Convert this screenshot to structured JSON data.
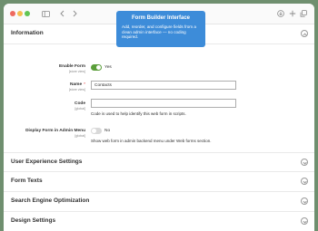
{
  "toolbar": {
    "sidebar_icon": "sidebar-icon",
    "back_icon": "chevron-left-icon",
    "forward_icon": "chevron-right-icon",
    "download_icon": "download-icon",
    "add_icon": "plus-icon",
    "copy_icon": "copy-icon"
  },
  "tooltip": {
    "title": "Form Builder Interface",
    "text": "Add, reorder, and configure fields from a clean admin interface — no coding required."
  },
  "sections": {
    "information": {
      "title": "Information",
      "fields": {
        "enable_form": {
          "label": "Enable Form",
          "scope": "[store view]",
          "value": "Yes",
          "on": true
        },
        "name": {
          "label": "Name",
          "required": "*",
          "scope": "[store view]",
          "value": "Contacts"
        },
        "code": {
          "label": "Code",
          "scope": "[global]",
          "value": "",
          "note": "Code is used to help identify this web form in scripts."
        },
        "display_in_admin_menu": {
          "label": "Display Form in Admin Menu",
          "scope": "[global]",
          "value": "No",
          "on": false,
          "note": "Show web form in admin backend menu under Web forms section."
        }
      }
    },
    "user_experience": {
      "title": "User Experience Settings"
    },
    "form_texts": {
      "title": "Form Texts"
    },
    "seo": {
      "title": "Search Engine Optimization"
    },
    "design": {
      "title": "Design Settings"
    }
  },
  "colors": {
    "accent_toggle": "#5a9e3a",
    "tooltip": "#3d8cd9",
    "required": "#e22626"
  }
}
